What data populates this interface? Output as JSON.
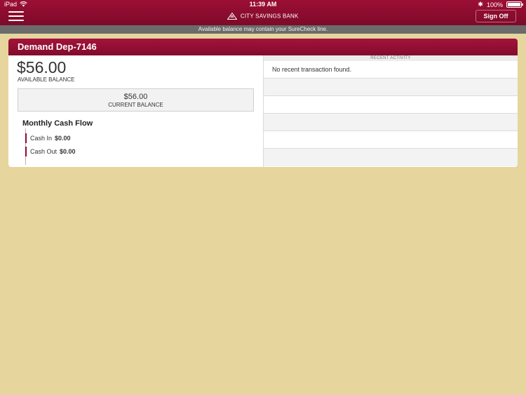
{
  "status_bar": {
    "device": "iPad",
    "time": "11:39 AM",
    "bluetooth": "✱",
    "battery": "100%"
  },
  "header": {
    "menu_icon": "hamburger-icon",
    "brand_name": "CITY SAVINGS BANK",
    "sign_off_label": "Sign Off"
  },
  "notice": {
    "text": "Available balance may contain your SureCheck line."
  },
  "account": {
    "title": "Demand Dep-7146",
    "available_amount": "$56.00",
    "available_label": "AVAILABLE BALANCE",
    "current_amount": "$56.00",
    "current_label": "CURRENT BALANCE"
  },
  "cash_flow": {
    "title": "Monthly Cash Flow",
    "cash_in_label": "Cash In",
    "cash_in_value": "$0.00",
    "cash_out_label": "Cash Out",
    "cash_out_value": "$0.00"
  },
  "recent_activity": {
    "header": "RECENT ACTIVITY",
    "empty_message": "No recent transaction found."
  },
  "colors": {
    "brand": "#8c0c2f",
    "background": "#e6d59c",
    "notice_bar": "#6b6b6b"
  }
}
